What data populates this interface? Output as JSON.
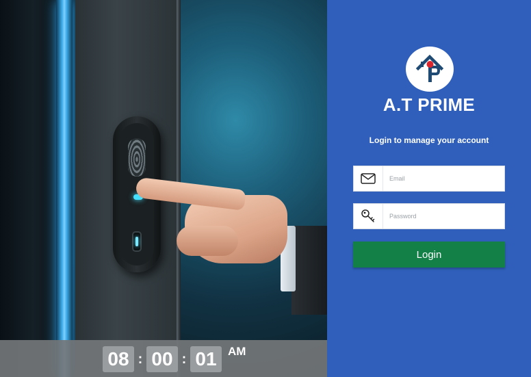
{
  "clock": {
    "hours": "08",
    "minutes": "00",
    "seconds": "01",
    "period": "AM"
  },
  "brand": {
    "name": "A.T PRIME",
    "logo_icon": "house-pin-logo"
  },
  "login": {
    "subtitle": "Login to manage your account",
    "email": {
      "placeholder": "Email",
      "value": "",
      "icon": "envelope-icon"
    },
    "password": {
      "placeholder": "Password",
      "value": "",
      "icon": "key-icon"
    },
    "button_label": "Login"
  },
  "colors": {
    "panel_bg": "#2f5fba",
    "button_bg": "#138047",
    "logo_accent": "#d9252b",
    "logo_dark": "#1f4a73"
  },
  "photo": {
    "subject": "hand-pressing-fingerprint-door-lock"
  }
}
